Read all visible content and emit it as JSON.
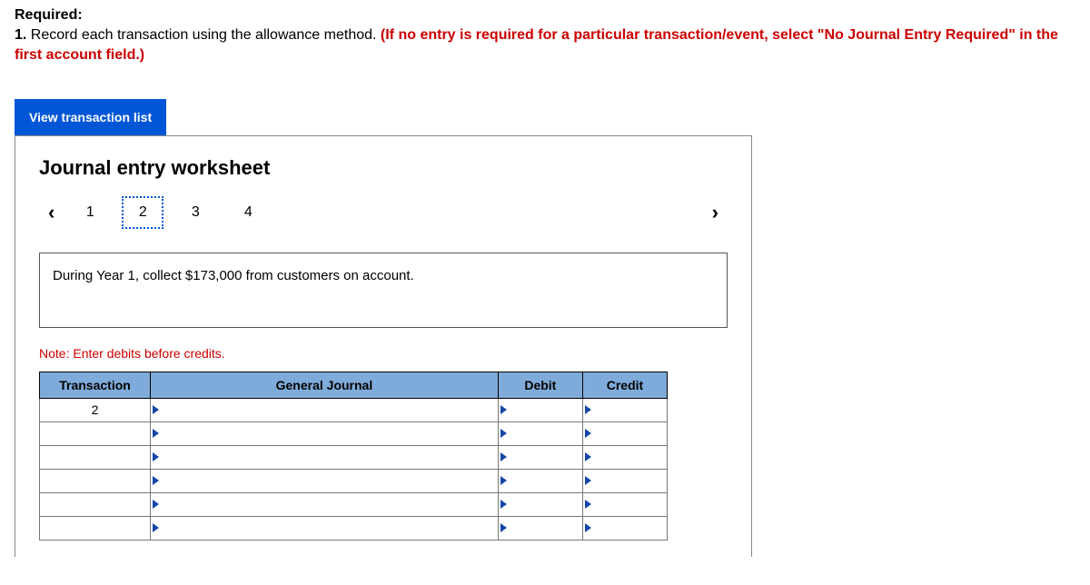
{
  "header": {
    "required_label": "Required:",
    "instruction_num": "1.",
    "instruction_black": " Record each transaction using the allowance method. ",
    "instruction_red": "(If no entry is required for a particular transaction/event, select \"No Journal Entry Required\" in the first account field.)"
  },
  "view_button": "View transaction list",
  "worksheet": {
    "title": "Journal entry worksheet",
    "tabs": [
      "1",
      "2",
      "3",
      "4"
    ],
    "selected_tab_index": 1,
    "prompt": "During Year 1, collect $173,000 from customers on account.",
    "note": "Note: Enter debits before credits.",
    "columns": {
      "transaction": "Transaction",
      "general_journal": "General Journal",
      "debit": "Debit",
      "credit": "Credit"
    },
    "rows": [
      {
        "transaction": "2",
        "gj": "",
        "debit": "",
        "credit": ""
      },
      {
        "transaction": "",
        "gj": "",
        "debit": "",
        "credit": ""
      },
      {
        "transaction": "",
        "gj": "",
        "debit": "",
        "credit": ""
      },
      {
        "transaction": "",
        "gj": "",
        "debit": "",
        "credit": ""
      },
      {
        "transaction": "",
        "gj": "",
        "debit": "",
        "credit": ""
      },
      {
        "transaction": "",
        "gj": "",
        "debit": "",
        "credit": ""
      }
    ]
  }
}
